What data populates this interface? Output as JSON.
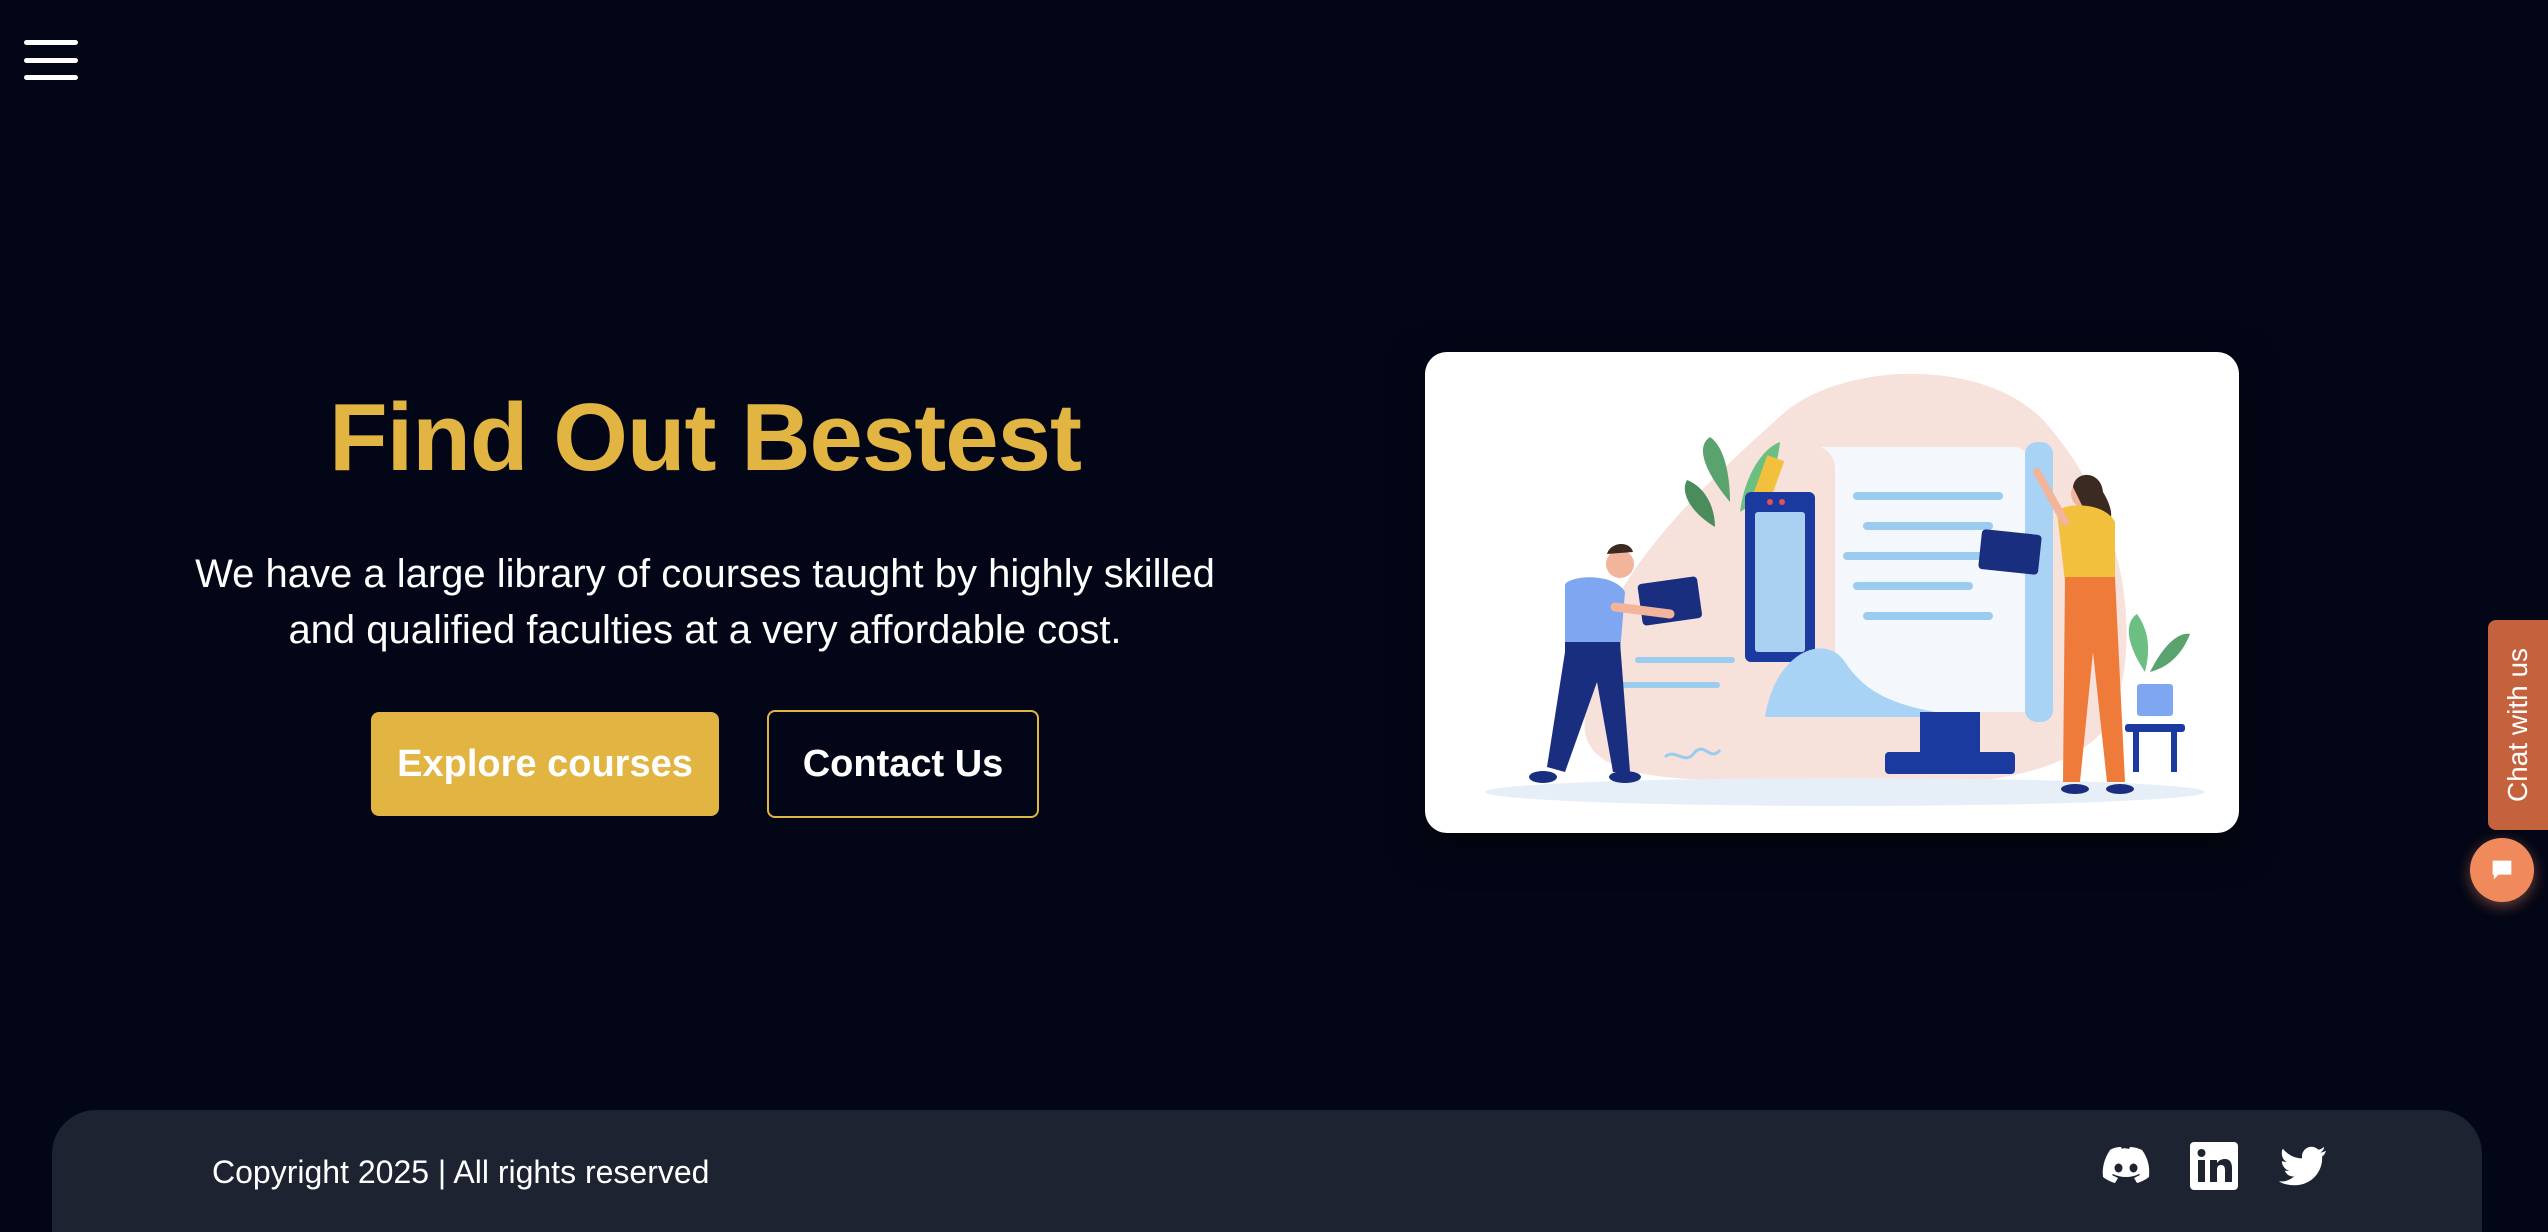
{
  "nav": {
    "menu_icon": "hamburger-menu-icon"
  },
  "hero": {
    "title": "Find Out Bestest",
    "description": "We have a large library of courses taught by highly skilled and qualified faculties at a very affordable cost.",
    "primary_button": "Explore courses",
    "secondary_button": "Contact Us"
  },
  "chat": {
    "tab_label": "Chat with us",
    "bubble_icon": "chat-bubble-icon"
  },
  "footer": {
    "copyright": "Copyright 2025 | All rights reserved",
    "socials": [
      "discord-icon",
      "linkedin-icon",
      "twitter-icon"
    ]
  },
  "colors": {
    "background": "#030616",
    "accent": "#e2b441",
    "footer_bg": "#1e2331",
    "chat_tab": "#c4623e",
    "chat_bubble": "#f08a5d"
  }
}
